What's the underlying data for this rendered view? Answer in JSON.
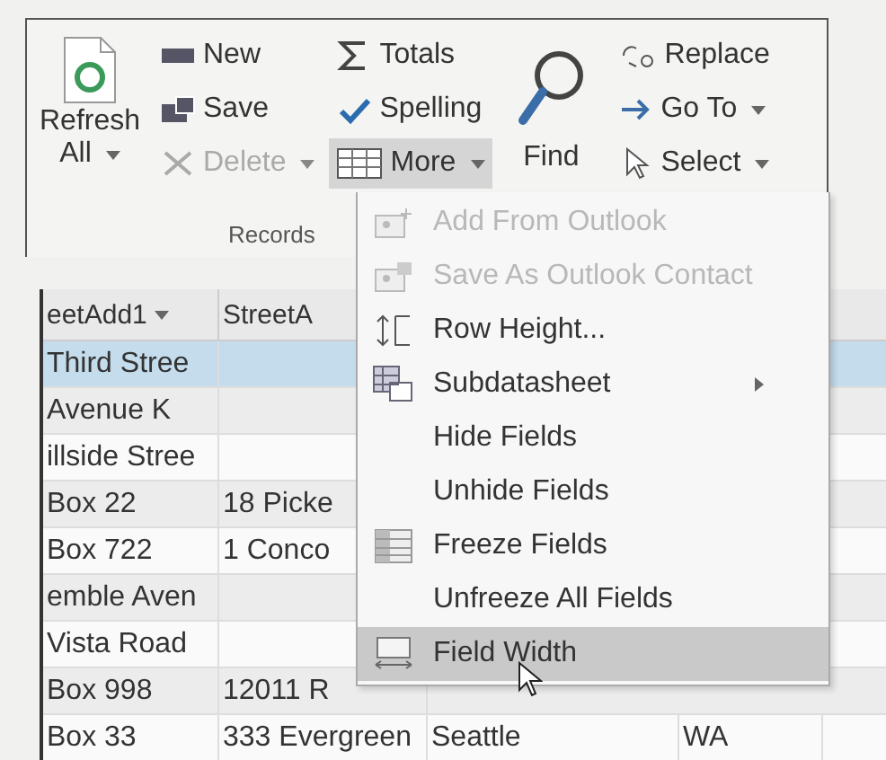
{
  "ribbon": {
    "refresh": {
      "lines": [
        "Refresh",
        "All"
      ],
      "dropdown": true
    },
    "record_commands": [
      {
        "label": "New",
        "disabled": false,
        "dropdown": false
      },
      {
        "label": "Save",
        "disabled": false,
        "dropdown": false
      },
      {
        "label": "Delete",
        "disabled": true,
        "dropdown": true
      }
    ],
    "data_commands": [
      {
        "label": "Totals",
        "pressed": false,
        "dropdown": false
      },
      {
        "label": "Spelling",
        "pressed": false,
        "dropdown": false
      },
      {
        "label": "More",
        "pressed": true,
        "dropdown": true
      }
    ],
    "find": {
      "label": "Find"
    },
    "find_commands": [
      {
        "label": "Replace",
        "dropdown": false
      },
      {
        "label": "Go To",
        "dropdown": true
      },
      {
        "label": "Select",
        "dropdown": true
      }
    ],
    "group_label": "Records"
  },
  "table": {
    "columns": [
      {
        "label": "eetAdd1",
        "filter_button": true
      },
      {
        "label": "StreetA",
        "filter_button": false
      }
    ],
    "rows": [
      {
        "cells": [
          "Third Stree",
          ""
        ],
        "selected": true
      },
      {
        "cells": [
          "Avenue K",
          ""
        ],
        "selected": false
      },
      {
        "cells": [
          "illside Stree",
          ""
        ],
        "selected": false
      },
      {
        "cells": [
          "Box 22",
          "18 Picke"
        ],
        "selected": false
      },
      {
        "cells": [
          "Box 722",
          "1 Conco"
        ],
        "selected": false
      },
      {
        "cells": [
          "emble Aven",
          ""
        ],
        "selected": false
      },
      {
        "cells": [
          "Vista Road",
          ""
        ],
        "selected": false
      },
      {
        "cells": [
          "Box 998",
          "12011 R"
        ],
        "selected": false
      },
      {
        "cells": [
          "Box 33",
          "333 Evergreen",
          "Seattle",
          "WA"
        ],
        "selected": false
      }
    ]
  },
  "more_menu": {
    "items": [
      {
        "label": "Add From Outlook",
        "disabled": true,
        "selected": false,
        "submenu": false,
        "kind": "contact-add"
      },
      {
        "label": "Save As Outlook Contact",
        "disabled": true,
        "selected": false,
        "submenu": false,
        "kind": "contact-save"
      },
      {
        "label": "Row Height...",
        "disabled": false,
        "selected": false,
        "submenu": false,
        "kind": "row-height"
      },
      {
        "label": "Subdatasheet",
        "disabled": false,
        "selected": false,
        "submenu": true,
        "kind": "subdatasheet"
      },
      {
        "label": "Hide Fields",
        "disabled": false,
        "selected": false,
        "submenu": false,
        "kind": "plain"
      },
      {
        "label": "Unhide Fields",
        "disabled": false,
        "selected": false,
        "submenu": false,
        "kind": "plain"
      },
      {
        "label": "Freeze Fields",
        "disabled": false,
        "selected": false,
        "submenu": false,
        "kind": "freeze"
      },
      {
        "label": "Unfreeze All Fields",
        "disabled": false,
        "selected": false,
        "submenu": false,
        "kind": "plain"
      },
      {
        "label": "Field Width",
        "disabled": false,
        "selected": true,
        "submenu": false,
        "kind": "field-width"
      }
    ]
  }
}
